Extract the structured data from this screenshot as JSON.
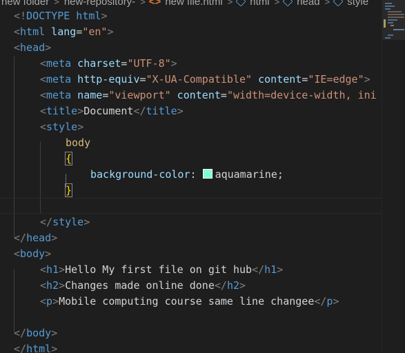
{
  "breadcrumb": {
    "items": [
      {
        "label": "new folder"
      },
      {
        "label": "new-repository-"
      },
      {
        "label": "new file.html",
        "icon": "html5-icon"
      },
      {
        "label": "html",
        "icon": "element-cube-icon"
      },
      {
        "label": "head",
        "icon": "element-cube-icon"
      },
      {
        "label": "style",
        "icon": "element-cube-icon"
      }
    ],
    "separator": ">"
  },
  "code": {
    "l1": {
      "a": "<!",
      "b": "DOCTYPE",
      "c": " html",
      "d": ">"
    },
    "l2": {
      "a": "<",
      "b": "html",
      "c": " lang",
      "d": "=",
      "e": "\"en\"",
      "f": ">"
    },
    "l3": {
      "a": "<",
      "b": "head",
      "c": ">"
    },
    "l4": {
      "a": "<",
      "b": "meta",
      "c": " charset",
      "d": "=",
      "e": "\"UTF-8\"",
      "f": ">"
    },
    "l5": {
      "a": "<",
      "b": "meta",
      "c": " http-equiv",
      "d": "=",
      "e": "\"X-UA-Compatible\"",
      "f": " content",
      "g": "=",
      "h": "\"IE=edge\"",
      "i": ">"
    },
    "l6": {
      "a": "<",
      "b": "meta",
      "c": " name",
      "d": "=",
      "e": "\"viewport\"",
      "f": " content",
      "g": "=",
      "h": "\"width=device-width, ini"
    },
    "l7": {
      "a": "<",
      "b": "title",
      "c": ">",
      "d": "Document",
      "e": "</",
      "f": "title",
      "g": ">"
    },
    "l8": {
      "a": "<",
      "b": "style",
      "c": ">"
    },
    "l9": {
      "a": "body"
    },
    "l10": {
      "a": "{"
    },
    "l11": {
      "a": "background-color",
      "b": ": ",
      "c": "aquamarine",
      "d": ";"
    },
    "l12": {
      "a": "}"
    },
    "l14": {
      "a": "</",
      "b": "style",
      "c": ">"
    },
    "l15": {
      "a": "</",
      "b": "head",
      "c": ">"
    },
    "l16": {
      "a": "<",
      "b": "body",
      "c": ">"
    },
    "l17": {
      "a": "<",
      "b": "h1",
      "c": ">",
      "d": "Hello My first file on git hub",
      "e": "</",
      "f": "h1",
      "g": ">"
    },
    "l18": {
      "a": "<",
      "b": "h2",
      "c": ">",
      "d": "Changes made online done",
      "e": "</",
      "f": "h2",
      "g": ">"
    },
    "l19": {
      "a": "<",
      "b": "p",
      "c": ">",
      "d": "Mobile computing course same line changee",
      "e": "</",
      "f": "p",
      "g": ">"
    },
    "l21": {
      "a": "</",
      "b": "body",
      "c": ">"
    },
    "l22": {
      "a": "</",
      "b": "html",
      "c": ">"
    }
  },
  "colors": {
    "swatch": "#7fffd4"
  }
}
